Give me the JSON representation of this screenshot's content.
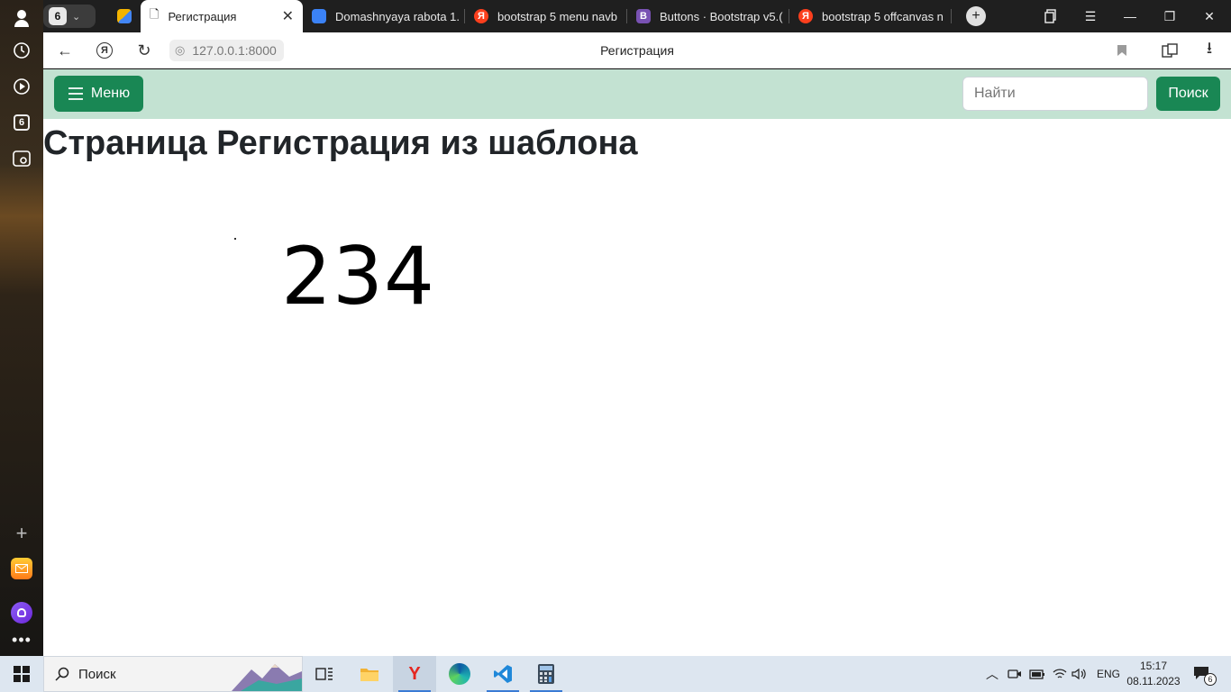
{
  "browser": {
    "tab_group_count": "6",
    "tabs": [
      {
        "title": "Регистрация",
        "active": true
      },
      {
        "title": "Domashnyaya rabota 1.",
        "active": false
      },
      {
        "title": "bootstrap 5 menu navb",
        "active": false
      },
      {
        "title": "Buttons · Bootstrap v5.(",
        "active": false
      },
      {
        "title": "bootstrap 5 offcanvas n",
        "active": false
      }
    ],
    "url": "127.0.0.1:8000",
    "page_title": "Регистрация"
  },
  "sidepanel": {
    "tabs_badge": "6"
  },
  "page": {
    "menu_label": "Меню",
    "search_placeholder": "Найти",
    "search_button": "Поиск",
    "heading": "Страница Регистрация из шаблона",
    "big_number": "234"
  },
  "taskbar": {
    "search_label": "Поиск",
    "language": "ENG",
    "time": "15:17",
    "date": "08.11.2023",
    "notifications": "6"
  },
  "colors": {
    "accent_green": "#198754",
    "navbar_bg": "#c3e2d2"
  }
}
